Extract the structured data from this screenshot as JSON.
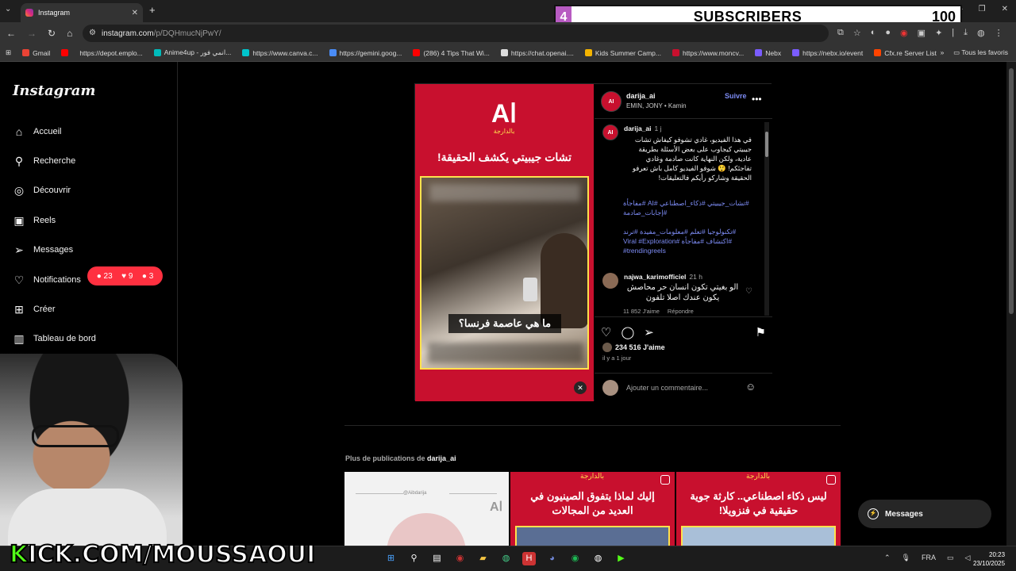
{
  "browser": {
    "tab_title": "Instagram",
    "url_host": "instagram.com",
    "url_path": "/p/DQHmucNjPwY/",
    "bookmarks": [
      "Gmail",
      "",
      "https://depot.emplo...",
      "Anime4up - انمي فور...",
      "https://www.canva.c...",
      "https://gemini.goog...",
      "(286) 4 Tips That Wi...",
      "https://chat.openai....",
      "Kids Summer Camp...",
      "https://www.moncv...",
      "Nebx",
      "https://nebx.io/event",
      "Cfx.re Server List"
    ],
    "all_bookmarks": "Tous les favoris"
  },
  "sub_goal": {
    "current": "4",
    "label": "SUBSCRIBERS",
    "goal": "100"
  },
  "ig": {
    "logo": "Instagram",
    "nav": [
      "Accueil",
      "Recherche",
      "Découvrir",
      "Reels",
      "Messages",
      "Notifications",
      "Créer",
      "Tableau de bord"
    ],
    "notif_pill": {
      "comments": "23",
      "likes": "9",
      "follows": "3"
    }
  },
  "post": {
    "reel": {
      "logo": "Aا",
      "logo_sub": "بالدارجة",
      "headline": "تشات جيبيتي يكشف الحقيقة!",
      "subtitle": "ما هي عاصمة فرنسا؟"
    },
    "username": "darija_ai",
    "music": "EMIN, JONY • Kamin",
    "follow": "Suivre",
    "caption_time": "1 j",
    "caption": "في هذا الفيديو، غادي تشوفو كيفاش تشات جيبيتي كيجاوب على بعض الأسئلة بطريقة عادية، ولكن النهاية كانت صادمة وغادي تفاجئكم! 😲 شوفو الفيديو كامل باش تعرفو الحقيقة وشاركو رأيكم فالتعليقات!",
    "tags1": "#تشات_جيبيتي #ذكاء_اصطناعي #AI #مفاجأة #إجابات_صادمة",
    "tags2": "#تكنولوجيا #تعلم #معلومات_مفيدة #ترند #اكتشاف #مفاجأة #Viral #Exploration #trendingreels",
    "comment": {
      "user": "najwa_karimofficiel",
      "time": "21 h",
      "text": "الو بغيتي تكون انسان حر محاصش يكون عندك اصلا تلفون",
      "likes": "11 852 J'aime",
      "reply": "Répondre"
    },
    "likes": "234 516 J'aime",
    "time_ago": "il y a 1 jour",
    "comment_placeholder": "Ajouter un commentaire..."
  },
  "more": {
    "prefix": "Plus de publications de",
    "user": "darija_ai",
    "cells": [
      {
        "text": "",
        "handle": "@Aibdarija"
      },
      {
        "text": "إليك لماذا يتفوق الصينيون في العديد من المجالات",
        "handle": ""
      },
      {
        "text": "ليس ذكاء اصطناعي.. كارثة جوية حقيقية في فنزويلا!",
        "handle": ""
      }
    ],
    "logo_sub": "بالدارجة"
  },
  "messages_btn": "Messages",
  "overlay": {
    "kick": "KICK.COM/MOUSSAOUI",
    "kick_first": "K"
  },
  "taskbar": {
    "lang": "FRA",
    "time": "20:23",
    "date": "23/10/2025"
  }
}
